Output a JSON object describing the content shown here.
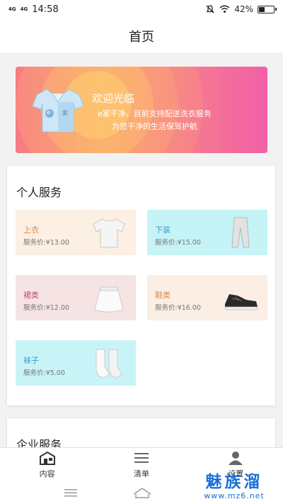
{
  "status_bar": {
    "signal_left": "4G",
    "signal_right": "4G",
    "time": "14:58",
    "battery": "42%",
    "battery_level": 0.42
  },
  "header": {
    "title": "首页"
  },
  "banner": {
    "welcome": "欢迎光临",
    "line1": "e家干净，目前支持配送洗衣服务",
    "line2": "为您干净的生活保驾护航",
    "shirt_left": "e",
    "shirt_right": "家"
  },
  "personal_services": {
    "title": "个人服务",
    "items": [
      {
        "name": "上衣",
        "price": "服务价:¥13.00",
        "icon": "tshirt-icon",
        "bg": "#fcefe3",
        "color": "#e08a4a"
      },
      {
        "name": "下装",
        "price": "服务价:¥15.00",
        "icon": "trousers-icon",
        "bg": "#c6f3f6",
        "color": "#3a9ccf"
      },
      {
        "name": "裙类",
        "price": "服务价:¥12.00",
        "icon": "skirt-icon",
        "bg": "#f6e3e3",
        "color": "#c0477e"
      },
      {
        "name": "鞋类",
        "price": "服务价:¥16.00",
        "icon": "sneaker-icon",
        "bg": "#fbeee4",
        "color": "#d9874e"
      },
      {
        "name": "袜子",
        "price": "服务价:¥5.00",
        "icon": "socks-icon",
        "bg": "#c9f4f7",
        "color": "#3a9ccf"
      }
    ]
  },
  "enterprise_services": {
    "title": "企业服务"
  },
  "tabbar": {
    "items": [
      {
        "label": "内容",
        "icon": "home-store-icon"
      },
      {
        "label": "清单",
        "icon": "list-icon"
      },
      {
        "label": "设置",
        "icon": "user-icon"
      }
    ]
  },
  "watermark": {
    "big": "魅族溜",
    "small": "www.mz6.net"
  },
  "colors": {
    "accent": "#f3708a",
    "watermark": "#1a6fd6"
  }
}
